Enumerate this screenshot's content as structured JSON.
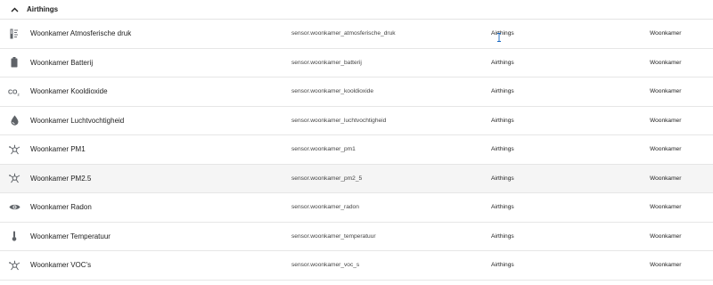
{
  "group": {
    "title": "Airthings",
    "collapse_icon": "chevron-up-icon"
  },
  "rows": [
    {
      "name": "Woonkamer Atmosferische druk",
      "entity": "sensor.woonkamer_atmosferische_druk",
      "integration": "Airthings",
      "area": "Woonkamer",
      "icon": "gauge-icon"
    },
    {
      "name": "Woonkamer Batterij",
      "entity": "sensor.woonkamer_batterij",
      "integration": "Airthings",
      "area": "Woonkamer",
      "icon": "battery-icon"
    },
    {
      "name": "Woonkamer Kooldioxide",
      "entity": "sensor.woonkamer_kooldioxide",
      "integration": "Airthings",
      "area": "Woonkamer",
      "icon": "co2-icon"
    },
    {
      "name": "Woonkamer Luchtvochtigheid",
      "entity": "sensor.woonkamer_luchtvochtigheid",
      "integration": "Airthings",
      "area": "Woonkamer",
      "icon": "water-drop-icon"
    },
    {
      "name": "Woonkamer PM1",
      "entity": "sensor.woonkamer_pm1",
      "integration": "Airthings",
      "area": "Woonkamer",
      "icon": "molecule-icon"
    },
    {
      "name": "Woonkamer PM2.5",
      "entity": "sensor.woonkamer_pm2_5",
      "integration": "Airthings",
      "area": "Woonkamer",
      "icon": "molecule-icon"
    },
    {
      "name": "Woonkamer Radon",
      "entity": "sensor.woonkamer_radon",
      "integration": "Airthings",
      "area": "Woonkamer",
      "icon": "eye-icon"
    },
    {
      "name": "Woonkamer Temperatuur",
      "entity": "sensor.woonkamer_temperatuur",
      "integration": "Airthings",
      "area": "Woonkamer",
      "icon": "thermometer-icon"
    },
    {
      "name": "Woonkamer VOC's",
      "entity": "sensor.woonkamer_voc_s",
      "integration": "Airthings",
      "area": "Woonkamer",
      "icon": "molecule-icon"
    }
  ]
}
